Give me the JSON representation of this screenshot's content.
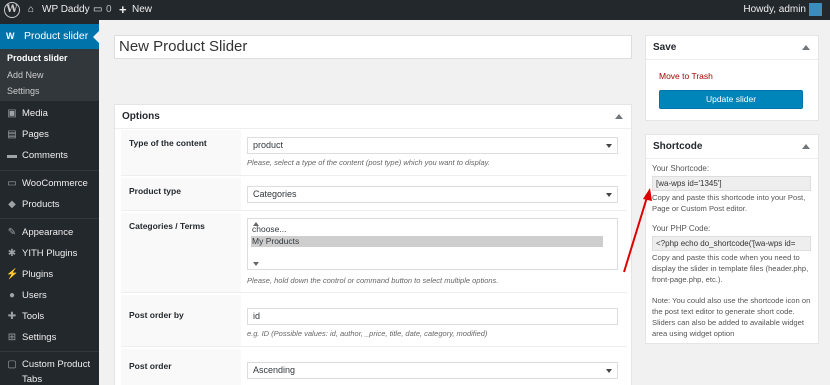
{
  "adminbar": {
    "site_name": "WP Daddy",
    "comment_count": "0",
    "new_label": "New",
    "howdy": "Howdy, admin"
  },
  "sidebar": {
    "current": {
      "icon_letter": "W",
      "label": "Product slider"
    },
    "submenu": [
      "Product slider",
      "Add New",
      "Settings"
    ],
    "items": [
      {
        "icon": "media-icon",
        "label": "Media"
      },
      {
        "icon": "pages-icon",
        "label": "Pages"
      },
      {
        "icon": "comments-icon",
        "label": "Comments"
      },
      {
        "icon": "woocommerce-icon",
        "label": "WooCommerce"
      },
      {
        "icon": "products-icon",
        "label": "Products"
      },
      {
        "icon": "appearance-icon",
        "label": "Appearance"
      },
      {
        "icon": "yith-icon",
        "label": "YITH Plugins"
      },
      {
        "icon": "plugins-icon",
        "label": "Plugins"
      },
      {
        "icon": "users-icon",
        "label": "Users"
      },
      {
        "icon": "tools-icon",
        "label": "Tools"
      },
      {
        "icon": "settings-icon",
        "label": "Settings"
      },
      {
        "icon": "custom-tabs-icon",
        "label": "Custom Product"
      },
      {
        "icon": "",
        "label": "Tabs"
      }
    ]
  },
  "editor": {
    "title": "New Product Slider"
  },
  "options": {
    "heading": "Options",
    "type_of_content": {
      "label": "Type of the content",
      "value": "product",
      "hint": "Please, select a type of the content (post type) which you want to display."
    },
    "product_type": {
      "label": "Product type",
      "value": "Categories"
    },
    "categories": {
      "label": "Categories / Terms",
      "options": [
        "choose...",
        "My Products"
      ],
      "hint": "Please, hold down the control or command button to select multiple options."
    },
    "post_order_by": {
      "label": "Post order by",
      "value": "id",
      "hint": "e.g. ID (Possible values: id, author, _price, title, date, category, modified)"
    },
    "post_order": {
      "label": "Post order",
      "value": "Ascending"
    }
  },
  "save": {
    "heading": "Save",
    "trash": "Move to Trash",
    "update": "Update slider"
  },
  "shortcode": {
    "heading": "Shortcode",
    "your_shortcode_label": "Your Shortcode:",
    "shortcode_value": "[wa-wps id='1345']",
    "shortcode_help": "Copy and paste this shortcode into your Post, Page or Custom Post editor.",
    "php_label": "Your PHP Code:",
    "php_value": "<?php echo do_shortcode('[wa-wps id=",
    "php_help": "Copy and paste this code when you need to display the slider in template files (header.php, front-page.php, etc.).",
    "note": "Note: You could also use the shortcode icon on the post text editor to generate short code. Sliders can also be added to available widget area using widget option"
  },
  "colors": {
    "adminbar": "#23282d",
    "accent": "#0073aa",
    "button": "#0085ba",
    "trash": "#a00",
    "annotation_arrow": "#d00"
  }
}
